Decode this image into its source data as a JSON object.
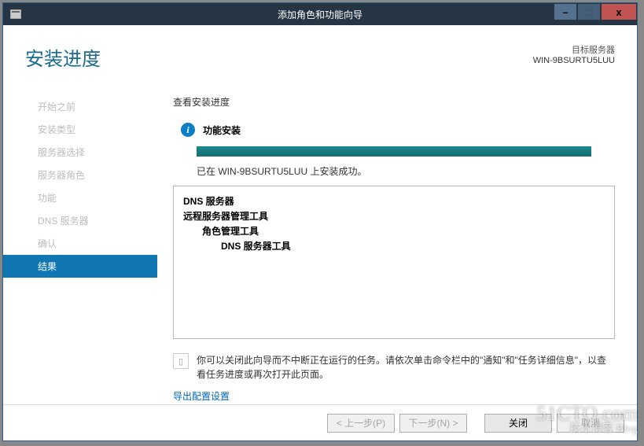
{
  "titlebar": {
    "title": "添加角色和功能向导",
    "min": "–",
    "max": "□",
    "close": "x"
  },
  "header": {
    "page_title": "安装进度",
    "server_label": "目标服务器",
    "server_name": "WIN-9BSURTU5LUU"
  },
  "sidebar": {
    "items": [
      {
        "label": "开始之前"
      },
      {
        "label": "安装类型"
      },
      {
        "label": "服务器选择"
      },
      {
        "label": "服务器角色"
      },
      {
        "label": "功能"
      },
      {
        "label": "DNS 服务器"
      },
      {
        "label": "确认"
      },
      {
        "label": "结果"
      }
    ]
  },
  "main": {
    "section_label": "查看安装进度",
    "status_text": "功能安装",
    "result_text": "已在 WIN-9BSURTU5LUU 上安装成功。",
    "result_tree": {
      "lvl1a": "DNS 服务器",
      "lvl1b": "远程服务器管理工具",
      "lvl2": "角色管理工具",
      "lvl3": "DNS 服务器工具"
    },
    "info_footer": "你可以关闭此向导而不中断正在运行的任务。请依次单击命令栏中的\"通知\"和\"任务详细信息\"，以查看任务进度或再次打开此页面。",
    "export_link": "导出配置设置"
  },
  "buttons": {
    "prev": "< 上一步(P)",
    "next": "下一步(N) >",
    "close": "关闭",
    "cancel": "取消"
  },
  "watermark": {
    "line1": "51CTO.com",
    "line2": "技术博客",
    "line3": "Blog"
  }
}
